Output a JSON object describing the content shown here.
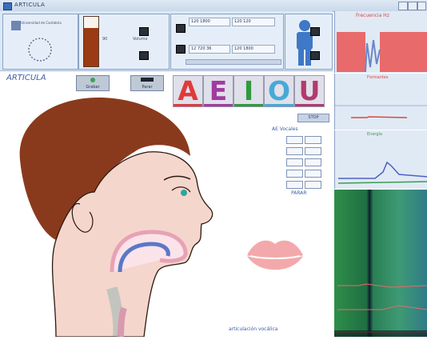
{
  "window": {
    "title": "ARTICULA"
  },
  "toolbar": {
    "pause_label": "Pause",
    "volume_label": "Volume",
    "stop_label": "STOP",
    "logo_text": "Universidad de Cantabria",
    "field_values": [
      "120 1800",
      "90",
      "120 120",
      "12 720 36"
    ]
  },
  "main": {
    "app_label": "ARTICULA",
    "start_label": "Grabar",
    "stop_label": "Parar",
    "vowels": [
      "A",
      "E",
      "I",
      "O",
      "U"
    ],
    "vowel_colors": [
      "#e03a3a",
      "#a23aa0",
      "#2f9a3c",
      "#47a9d8",
      "#b23a6e"
    ],
    "table_header": "AE Vocales",
    "table_status_label": "PARAR",
    "footer_text": "articulación vocálica"
  },
  "right_panels": {
    "top_label": "Frecuencia Hz",
    "mid_label": "Formantes",
    "low_label": "Energía"
  },
  "colors": {
    "titlebar": "#d2dfee",
    "panel_bg": "#e5eef8",
    "skin": "#f5d6cc",
    "hair": "#8a3a1c",
    "lips": "#f3a9ab",
    "spectro_green": "#2f8f4a",
    "waveform_red": "#e86a6a"
  }
}
